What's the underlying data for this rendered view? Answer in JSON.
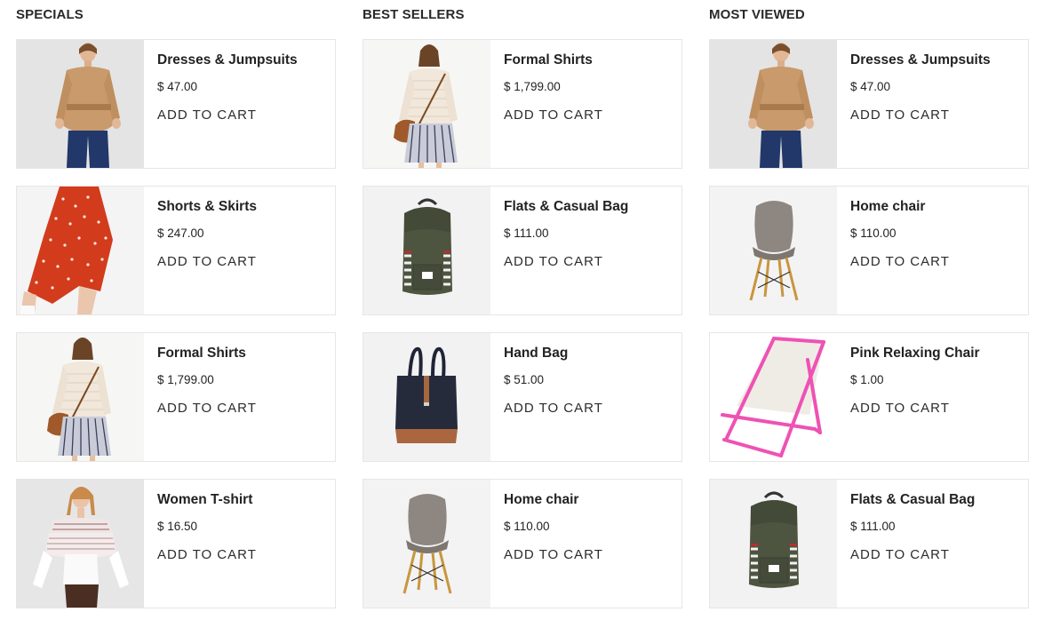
{
  "columns": [
    {
      "title": "SPECIALS",
      "products": [
        {
          "name": "Dresses & Jumpsuits",
          "price": "$ 47.00",
          "cta": "ADD TO CART",
          "image": "woman-tan-jacket"
        },
        {
          "name": "Shorts & Skirts",
          "price": "$ 247.00",
          "cta": "ADD TO CART",
          "image": "red-polka-skirt"
        },
        {
          "name": "Formal Shirts",
          "price": "$ 1,799.00",
          "cta": "ADD TO CART",
          "image": "woman-knit-sweater"
        },
        {
          "name": "Women T-shirt",
          "price": "$ 16.50",
          "cta": "ADD TO CART",
          "image": "woman-ruffle-top"
        }
      ]
    },
    {
      "title": "BEST SELLERS",
      "products": [
        {
          "name": "Formal Shirts",
          "price": "$ 1,799.00",
          "cta": "ADD TO CART",
          "image": "woman-knit-sweater"
        },
        {
          "name": "Flats & Casual Bag",
          "price": "$ 111.00",
          "cta": "ADD TO CART",
          "image": "green-backpack"
        },
        {
          "name": "Hand Bag",
          "price": "$ 51.00",
          "cta": "ADD TO CART",
          "image": "navy-tote-bag"
        },
        {
          "name": "Home chair",
          "price": "$ 110.00",
          "cta": "ADD TO CART",
          "image": "grey-shell-chair"
        }
      ]
    },
    {
      "title": "MOST VIEWED",
      "products": [
        {
          "name": "Dresses & Jumpsuits",
          "price": "$ 47.00",
          "cta": "ADD TO CART",
          "image": "woman-tan-jacket"
        },
        {
          "name": "Home chair",
          "price": "$ 110.00",
          "cta": "ADD TO CART",
          "image": "grey-shell-chair"
        },
        {
          "name": "Pink Relaxing Chair",
          "price": "$ 1.00",
          "cta": "ADD TO CART",
          "image": "pink-deck-chair"
        },
        {
          "name": "Flats & Casual Bag",
          "price": "$ 111.00",
          "cta": "ADD TO CART",
          "image": "green-backpack"
        }
      ]
    }
  ]
}
